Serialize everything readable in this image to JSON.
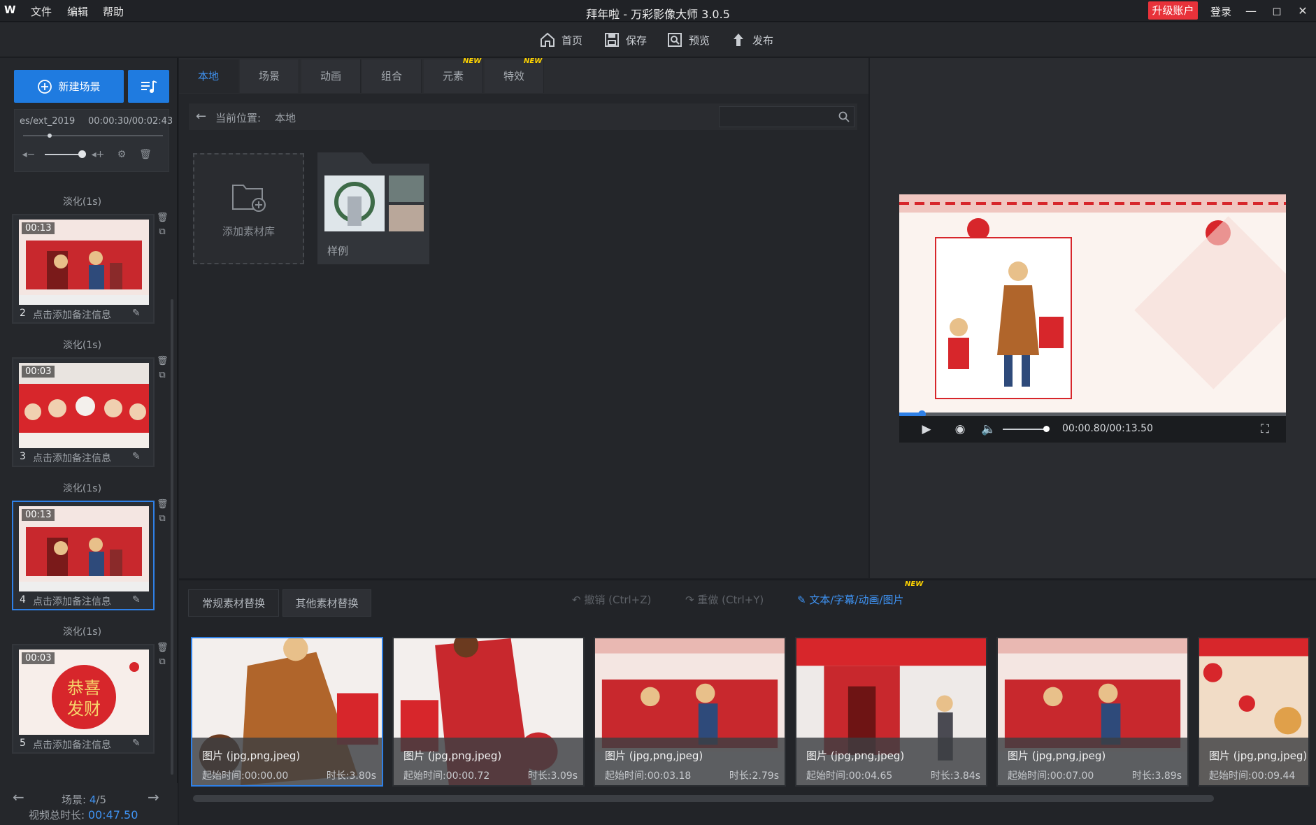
{
  "app": {
    "title": "拜年啦 - 万彩影像大师 3.0.5",
    "logo": "W",
    "upgrade": "升级账户",
    "login": "登录"
  },
  "menu": [
    "文件",
    "编辑",
    "帮助"
  ],
  "toolbar": {
    "home": "首页",
    "save": "保存",
    "preview": "预览",
    "publish": "发布"
  },
  "left": {
    "new_scene": "新建场景",
    "audio": {
      "name": "es/ext_2019",
      "time": "00:00:30/00:02:43"
    },
    "transition": "淡化(1s)",
    "scenes": [
      {
        "num": "2",
        "duration": "00:13",
        "note": "点击添加备注信息"
      },
      {
        "num": "3",
        "duration": "00:03",
        "note": "点击添加备注信息"
      },
      {
        "num": "4",
        "duration": "00:13",
        "note": "点击添加备注信息"
      },
      {
        "num": "5",
        "duration": "00:03",
        "note": "点击添加备注信息"
      }
    ],
    "scene_label": "场景:",
    "scene_current": "4",
    "scene_total": "/5",
    "total_label": "视频总时长:",
    "total_duration": "00:47.50",
    "greeting": "恭喜发财"
  },
  "tabs": [
    {
      "label": "本地",
      "new": ""
    },
    {
      "label": "场景",
      "new": ""
    },
    {
      "label": "动画",
      "new": ""
    },
    {
      "label": "组合",
      "new": ""
    },
    {
      "label": "元素",
      "new": "NEW"
    },
    {
      "label": "特效",
      "new": "NEW"
    }
  ],
  "path": {
    "label": "当前位置:",
    "value": "本地"
  },
  "library": {
    "add": "添加素材库",
    "sample": "样例"
  },
  "player": {
    "time": "00:00.80/00:13.50"
  },
  "bottom": {
    "tab1": "常规素材替换",
    "tab2": "其他素材替换",
    "undo": "撤销 (Ctrl+Z)",
    "redo": "重做 (Ctrl+Y)",
    "text_link": "文本/字幕/动画/图片",
    "text_new": "NEW"
  },
  "materials": [
    {
      "type": "图片 (jpg,png,jpeg)",
      "start": "起始时间:00:00.00",
      "duration": "时长:3.80s"
    },
    {
      "type": "图片 (jpg,png,jpeg)",
      "start": "起始时间:00:00.72",
      "duration": "时长:3.09s"
    },
    {
      "type": "图片 (jpg,png,jpeg)",
      "start": "起始时间:00:03.18",
      "duration": "时长:2.79s"
    },
    {
      "type": "图片 (jpg,png,jpeg)",
      "start": "起始时间:00:04.65",
      "duration": "时长:3.84s"
    },
    {
      "type": "图片 (jpg,png,jpeg)",
      "start": "起始时间:00:07.00",
      "duration": "时长:3.89s"
    },
    {
      "type": "图片 (jpg,png,jpeg)",
      "start": "起始时间:00:09.44",
      "duration": ""
    }
  ],
  "colors": {
    "accent": "#2f80e6",
    "upgrade": "#e8323a",
    "new_badge": "#ffd400",
    "festive_red": "#d7262b"
  }
}
